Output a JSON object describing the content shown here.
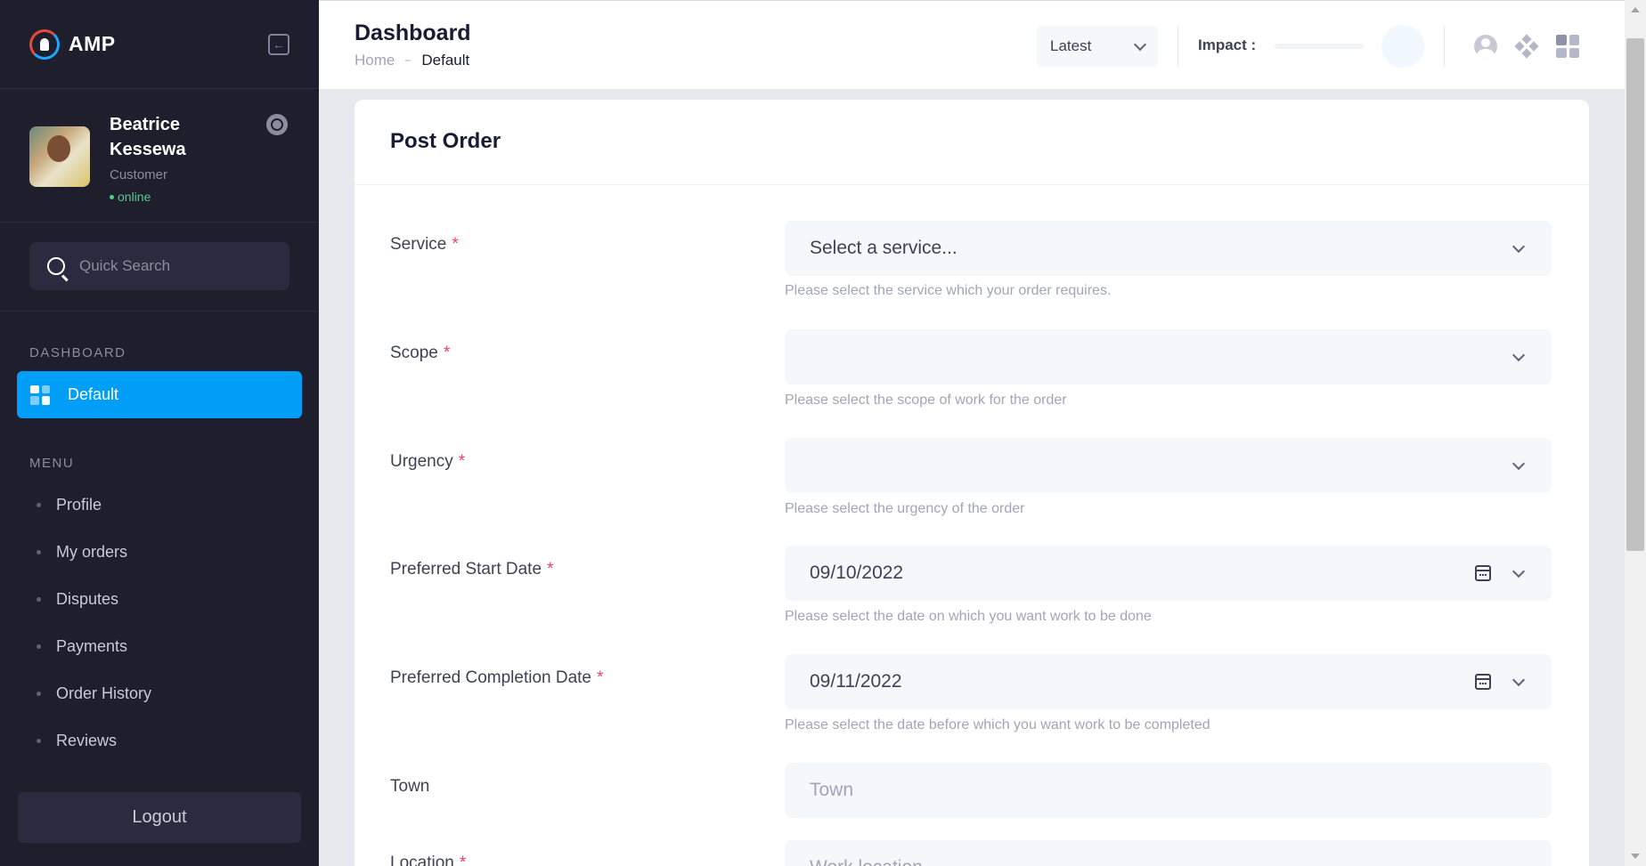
{
  "brand": {
    "name": "AMP"
  },
  "user": {
    "first_name": "Beatrice",
    "last_name": "Kessewa",
    "role": "Customer",
    "status": "online"
  },
  "search": {
    "placeholder": "Quick Search"
  },
  "sidebar": {
    "dashboard_section": "DASHBOARD",
    "active_item": "Default",
    "menu_section": "MENU",
    "items": [
      {
        "label": "Profile"
      },
      {
        "label": "My orders"
      },
      {
        "label": "Disputes"
      },
      {
        "label": "Payments"
      },
      {
        "label": "Order History"
      },
      {
        "label": "Reviews"
      }
    ],
    "logout_label": "Logout"
  },
  "header": {
    "title": "Dashboard",
    "breadcrumb": {
      "home": "Home",
      "current": "Default"
    },
    "filter_selected": "Latest",
    "impact_label": "Impact :",
    "impact_value": 0
  },
  "form": {
    "title": "Post Order",
    "service": {
      "label": "Service",
      "value": "Select a service...",
      "help": "Please select the service which your order requires."
    },
    "scope": {
      "label": "Scope",
      "value": "",
      "help": "Please select the scope of work for the order"
    },
    "urgency": {
      "label": "Urgency",
      "value": "",
      "help": "Please select the urgency of the order"
    },
    "start_date": {
      "label": "Preferred Start Date",
      "value": "09/10/2022",
      "help": "Please select the date on which you want work to be done"
    },
    "completion_date": {
      "label": "Preferred Completion Date",
      "value": "09/11/2022",
      "help": "Please select the date before which you want work to be completed"
    },
    "town": {
      "label": "Town",
      "placeholder": "Town"
    },
    "location": {
      "label": "Location",
      "placeholder": "Work location"
    },
    "required_mark": "*"
  },
  "colors": {
    "sidebar_bg": "#1e1e2d",
    "accent": "#009ef7",
    "required": "#f1416c",
    "online": "#50cd89"
  }
}
